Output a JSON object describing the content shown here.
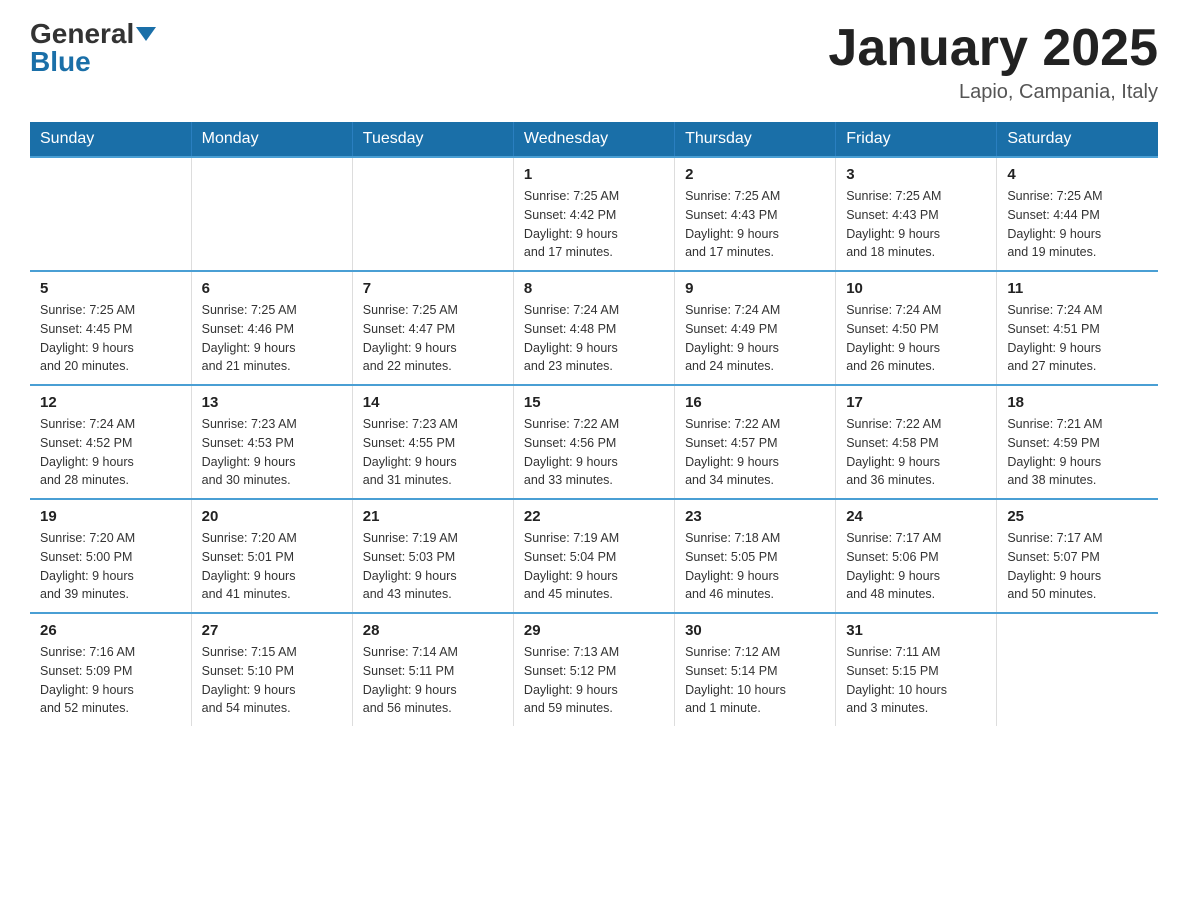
{
  "header": {
    "logo_text_general": "General",
    "logo_text_blue": "Blue",
    "month_title": "January 2025",
    "location": "Lapio, Campania, Italy"
  },
  "weekdays": [
    "Sunday",
    "Monday",
    "Tuesday",
    "Wednesday",
    "Thursday",
    "Friday",
    "Saturday"
  ],
  "weeks": [
    [
      {
        "day": "",
        "info": ""
      },
      {
        "day": "",
        "info": ""
      },
      {
        "day": "",
        "info": ""
      },
      {
        "day": "1",
        "info": "Sunrise: 7:25 AM\nSunset: 4:42 PM\nDaylight: 9 hours\nand 17 minutes."
      },
      {
        "day": "2",
        "info": "Sunrise: 7:25 AM\nSunset: 4:43 PM\nDaylight: 9 hours\nand 17 minutes."
      },
      {
        "day": "3",
        "info": "Sunrise: 7:25 AM\nSunset: 4:43 PM\nDaylight: 9 hours\nand 18 minutes."
      },
      {
        "day": "4",
        "info": "Sunrise: 7:25 AM\nSunset: 4:44 PM\nDaylight: 9 hours\nand 19 minutes."
      }
    ],
    [
      {
        "day": "5",
        "info": "Sunrise: 7:25 AM\nSunset: 4:45 PM\nDaylight: 9 hours\nand 20 minutes."
      },
      {
        "day": "6",
        "info": "Sunrise: 7:25 AM\nSunset: 4:46 PM\nDaylight: 9 hours\nand 21 minutes."
      },
      {
        "day": "7",
        "info": "Sunrise: 7:25 AM\nSunset: 4:47 PM\nDaylight: 9 hours\nand 22 minutes."
      },
      {
        "day": "8",
        "info": "Sunrise: 7:24 AM\nSunset: 4:48 PM\nDaylight: 9 hours\nand 23 minutes."
      },
      {
        "day": "9",
        "info": "Sunrise: 7:24 AM\nSunset: 4:49 PM\nDaylight: 9 hours\nand 24 minutes."
      },
      {
        "day": "10",
        "info": "Sunrise: 7:24 AM\nSunset: 4:50 PM\nDaylight: 9 hours\nand 26 minutes."
      },
      {
        "day": "11",
        "info": "Sunrise: 7:24 AM\nSunset: 4:51 PM\nDaylight: 9 hours\nand 27 minutes."
      }
    ],
    [
      {
        "day": "12",
        "info": "Sunrise: 7:24 AM\nSunset: 4:52 PM\nDaylight: 9 hours\nand 28 minutes."
      },
      {
        "day": "13",
        "info": "Sunrise: 7:23 AM\nSunset: 4:53 PM\nDaylight: 9 hours\nand 30 minutes."
      },
      {
        "day": "14",
        "info": "Sunrise: 7:23 AM\nSunset: 4:55 PM\nDaylight: 9 hours\nand 31 minutes."
      },
      {
        "day": "15",
        "info": "Sunrise: 7:22 AM\nSunset: 4:56 PM\nDaylight: 9 hours\nand 33 minutes."
      },
      {
        "day": "16",
        "info": "Sunrise: 7:22 AM\nSunset: 4:57 PM\nDaylight: 9 hours\nand 34 minutes."
      },
      {
        "day": "17",
        "info": "Sunrise: 7:22 AM\nSunset: 4:58 PM\nDaylight: 9 hours\nand 36 minutes."
      },
      {
        "day": "18",
        "info": "Sunrise: 7:21 AM\nSunset: 4:59 PM\nDaylight: 9 hours\nand 38 minutes."
      }
    ],
    [
      {
        "day": "19",
        "info": "Sunrise: 7:20 AM\nSunset: 5:00 PM\nDaylight: 9 hours\nand 39 minutes."
      },
      {
        "day": "20",
        "info": "Sunrise: 7:20 AM\nSunset: 5:01 PM\nDaylight: 9 hours\nand 41 minutes."
      },
      {
        "day": "21",
        "info": "Sunrise: 7:19 AM\nSunset: 5:03 PM\nDaylight: 9 hours\nand 43 minutes."
      },
      {
        "day": "22",
        "info": "Sunrise: 7:19 AM\nSunset: 5:04 PM\nDaylight: 9 hours\nand 45 minutes."
      },
      {
        "day": "23",
        "info": "Sunrise: 7:18 AM\nSunset: 5:05 PM\nDaylight: 9 hours\nand 46 minutes."
      },
      {
        "day": "24",
        "info": "Sunrise: 7:17 AM\nSunset: 5:06 PM\nDaylight: 9 hours\nand 48 minutes."
      },
      {
        "day": "25",
        "info": "Sunrise: 7:17 AM\nSunset: 5:07 PM\nDaylight: 9 hours\nand 50 minutes."
      }
    ],
    [
      {
        "day": "26",
        "info": "Sunrise: 7:16 AM\nSunset: 5:09 PM\nDaylight: 9 hours\nand 52 minutes."
      },
      {
        "day": "27",
        "info": "Sunrise: 7:15 AM\nSunset: 5:10 PM\nDaylight: 9 hours\nand 54 minutes."
      },
      {
        "day": "28",
        "info": "Sunrise: 7:14 AM\nSunset: 5:11 PM\nDaylight: 9 hours\nand 56 minutes."
      },
      {
        "day": "29",
        "info": "Sunrise: 7:13 AM\nSunset: 5:12 PM\nDaylight: 9 hours\nand 59 minutes."
      },
      {
        "day": "30",
        "info": "Sunrise: 7:12 AM\nSunset: 5:14 PM\nDaylight: 10 hours\nand 1 minute."
      },
      {
        "day": "31",
        "info": "Sunrise: 7:11 AM\nSunset: 5:15 PM\nDaylight: 10 hours\nand 3 minutes."
      },
      {
        "day": "",
        "info": ""
      }
    ]
  ]
}
